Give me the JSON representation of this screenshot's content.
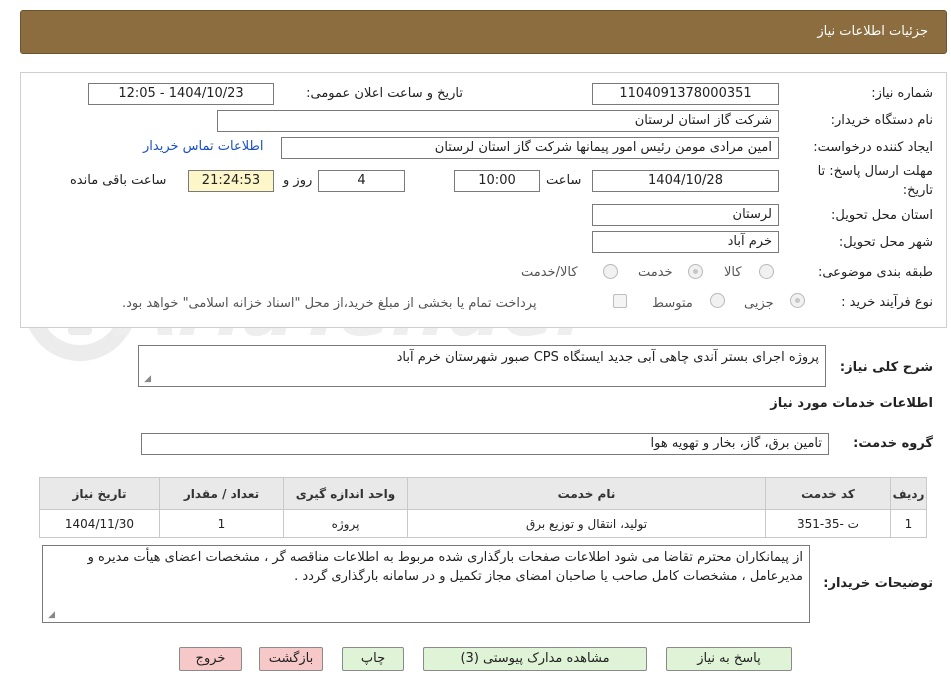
{
  "header": {
    "title": "جزئیات اطلاعات نیاز"
  },
  "form": {
    "need_number_label": "شماره نیاز:",
    "need_number": "1104091378000351",
    "announce_label": "تاریخ و ساعت اعلان عمومی:",
    "announce_value": "1404/10/23 - 12:05",
    "buyer_org_label": "نام دستگاه خریدار:",
    "buyer_org": "شرکت گاز استان لرستان",
    "creator_label": "ایجاد کننده درخواست:",
    "creator": "امین مرادی مومن رئیس امور پیمانها شرکت گاز استان لرستان",
    "contact_link": "اطلاعات تماس خریدار",
    "deadline_label_1": "مهلت ارسال پاسخ: تا",
    "deadline_label_2": "تاریخ:",
    "deadline_date": "1404/10/28",
    "time_label": "ساعت",
    "deadline_time": "10:00",
    "days_value": "4",
    "days_label": "روز و",
    "countdown": "21:24:53",
    "remaining_label": "ساعت باقی مانده",
    "province_label": "استان محل تحویل:",
    "province": "لرستان",
    "city_label": "شهر محل تحویل:",
    "city": "خرم آباد",
    "category_label": "طبقه بندی موضوعی:",
    "category_options": [
      "کالا",
      "خدمت",
      "کالا/خدمت"
    ],
    "category_selected": "خدمت",
    "process_label": "نوع فرآیند خرید :",
    "process_options": [
      "جزیی",
      "متوسط"
    ],
    "process_selected": "جزیی",
    "treasury_note": "پرداخت تمام یا بخشی از مبلغ خرید،از محل \"اسناد خزانه اسلامی\" خواهد بود."
  },
  "description": {
    "label": "شرح کلی نیاز:",
    "value": "پروژه اجرای بستر آندی چاهی آبی جدید ایستگاه CPS صبور شهرستان خرم آباد"
  },
  "services": {
    "section_title": "اطلاعات خدمات مورد نیاز",
    "group_label": "گروه خدمت:",
    "group_value": "تامین برق، گاز، بخار و تهویه هوا",
    "columns": [
      "ردیف",
      "کد خدمت",
      "نام خدمت",
      "واحد اندازه گیری",
      "تعداد / مقدار",
      "تاریخ نیاز"
    ],
    "rows": [
      [
        "1",
        "ت -35-351",
        "تولید، انتقال و توزیع برق",
        "پروژه",
        "1",
        "1404/11/30"
      ]
    ]
  },
  "buyer_notes": {
    "label": "توضیحات خریدار:",
    "value": "از پیمانکاران محترم تقاضا می شود اطلاعات صفحات بارگذاری شده مربوط به اطلاعات مناقصه گر ، مشخصات اعضای هیأت مدیره و مدیرعامل ، مشخصات کامل صاحب یا صاحبان امضای مجاز تکمیل و در سامانه بارگذاری گردد ."
  },
  "buttons": {
    "reply": "پاسخ به نیاز",
    "attachments": "مشاهده مدارک پیوستی (3)",
    "print": "چاپ",
    "back": "بازگشت",
    "exit": "خروج"
  },
  "colors": {
    "header_bg": "#8c6d3f",
    "button_green": "#dff3d6",
    "button_pink": "#f7c8c8",
    "countdown_bg": "#fdf6c8",
    "link": "#1a4fc7"
  }
}
